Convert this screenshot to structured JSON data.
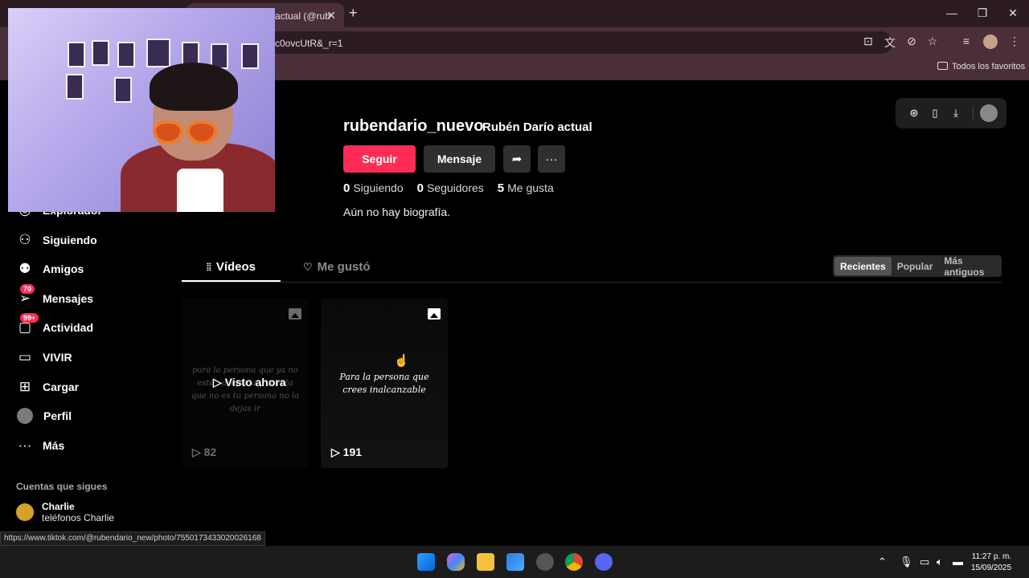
{
  "browser": {
    "tab_title": "actual (@rub",
    "url": "c0ovcUtR&_r=1",
    "bookmarks_folder": "Todos los favoritos",
    "status_url": "https://www.tiktok.com/@rubendario_new/photo/7550173433020026168"
  },
  "profile": {
    "username": "rubendario_nuevo",
    "nickname": "Rubén Darío actual",
    "follow_label": "Seguir",
    "message_label": "Mensaje",
    "stats": [
      {
        "value": "0",
        "label": "Siguiendo"
      },
      {
        "value": "0",
        "label": "Seguidores"
      },
      {
        "value": "5",
        "label": "Me gusta"
      }
    ],
    "bio": "Aún no hay biografía."
  },
  "sidebar": {
    "items": [
      {
        "label": "Explorador"
      },
      {
        "label": "Siguiendo"
      },
      {
        "label": "Amigos"
      },
      {
        "label": "Mensajes",
        "badge": "70"
      },
      {
        "label": "Actividad",
        "badge": "99+"
      },
      {
        "label": "VIVIR"
      },
      {
        "label": "Cargar"
      },
      {
        "label": "Perfil"
      },
      {
        "label": "Más"
      }
    ],
    "following_title": "Cuentas que sigues",
    "following": [
      {
        "name": "Charlie",
        "handle": "teléfonos Charlie"
      }
    ]
  },
  "tabs": {
    "videos": "Vídeos",
    "liked": "Me gustó"
  },
  "sort": {
    "options": [
      "Recientes",
      "Popular",
      "Más antiguos"
    ],
    "selected": "Recientes"
  },
  "videos": [
    {
      "caption": "para la persona que ya no esta , aceptala y acepta que no es tu persona no la dejas ir",
      "views": "82",
      "overlay": "Visto ahora"
    },
    {
      "caption": "Para la persona que crees inalcanzable",
      "views": "191"
    }
  ],
  "taskbar": {
    "time": "11:27 p. m.",
    "date": "15/09/2025"
  },
  "colors": {
    "accent": "#fe2c55",
    "chrome": "#4a2f38"
  }
}
